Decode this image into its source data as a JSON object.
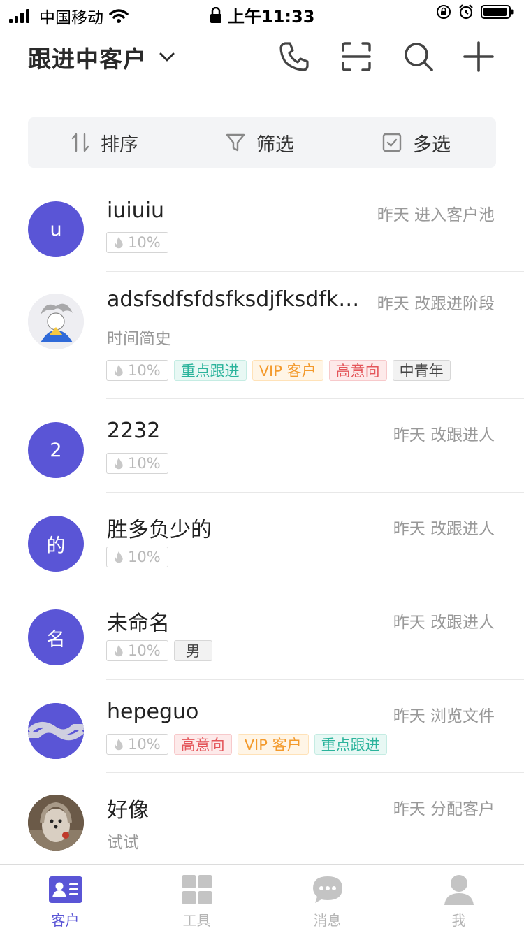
{
  "status_bar": {
    "carrier": "中国移动",
    "time": "上午11:33"
  },
  "header": {
    "title": "跟进中客户"
  },
  "toolbar": {
    "sort_label": "排序",
    "filter_label": "筛选",
    "multiselect_label": "多选"
  },
  "customers": [
    {
      "name": "iuiuiu",
      "avatar_text": "u",
      "activity": "昨天 进入客户池",
      "intent": "10%",
      "tags": []
    },
    {
      "name": "adsfsdfsfdsfksdjfksdfk…",
      "avatar_text": "",
      "activity": "昨天 改跟进阶段",
      "note": "时间简史",
      "intent": "10%",
      "tags": [
        "重点跟进",
        "VIP 客户",
        "高意向",
        "中青年"
      ]
    },
    {
      "name": "2232",
      "avatar_text": "2",
      "activity": "昨天 改跟进人",
      "intent": "10%",
      "tags": []
    },
    {
      "name": "胜多负少的",
      "avatar_text": "的",
      "activity": "昨天 改跟进人",
      "intent": "10%",
      "tags": []
    },
    {
      "name": "未命名",
      "avatar_text": "名",
      "activity": "昨天 改跟进人",
      "intent": "10%",
      "tags": [
        "男"
      ]
    },
    {
      "name": "hepeguo",
      "avatar_text": "",
      "activity": "昨天 浏览文件",
      "intent": "10%",
      "tags": [
        "高意向",
        "VIP 客户",
        "重点跟进"
      ]
    },
    {
      "name": "好像",
      "avatar_text": "",
      "activity": "昨天 分配客户",
      "note": "试试",
      "intent": "",
      "tags": []
    }
  ],
  "tabbar": {
    "tabs": [
      "客户",
      "工具",
      "消息",
      "我"
    ],
    "active": "客户"
  },
  "colors": {
    "accent": "#5a55d6",
    "teal": "#2ab39b",
    "orange": "#f39a2c",
    "red": "#e4555a"
  }
}
